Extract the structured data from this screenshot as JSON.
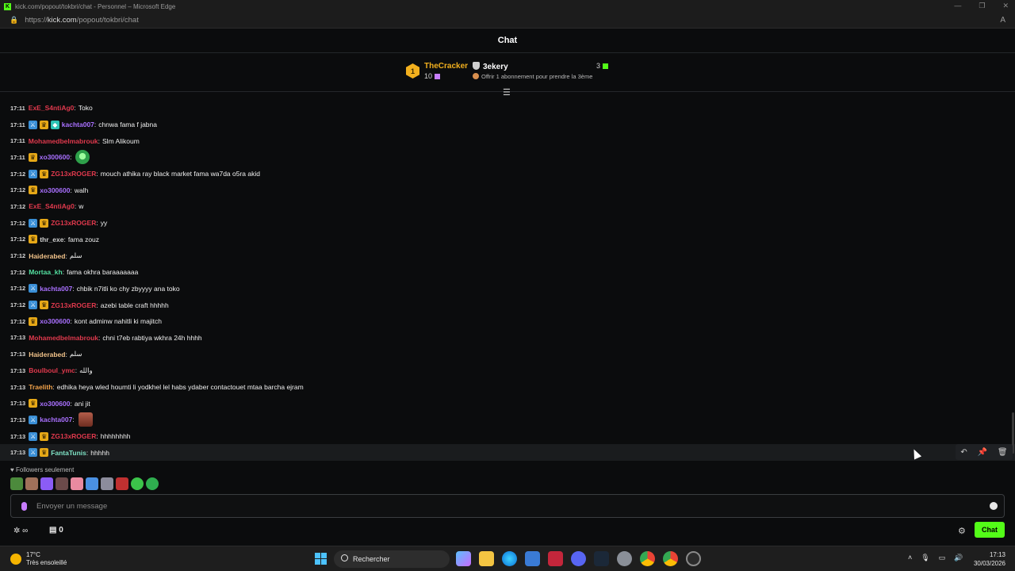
{
  "browser": {
    "title": "kick.com/popout/tokbri/chat - Personnel – Microsoft Edge",
    "url_prefix": "https://",
    "url_domain": "kick.com",
    "url_path": "/popout/tokbri/chat"
  },
  "chat": {
    "header_title": "Chat"
  },
  "gifters": {
    "first": {
      "rank": "1",
      "name": "TheCracker",
      "count": "10"
    },
    "second": {
      "name": "3ekery",
      "count": "3",
      "offer": "Offrir 1 abonnement pour prendre la 3ème"
    }
  },
  "messages": [
    {
      "time": "17:11",
      "badges": [],
      "user": "ExE_S4ntiAg0",
      "color": "#e0394d",
      "text": "Toko"
    },
    {
      "time": "17:11",
      "badges": [
        "mod",
        "sub",
        "vip"
      ],
      "user": "kachta007",
      "color": "#a970ff",
      "text": "chnwa fama f jabna"
    },
    {
      "time": "17:11",
      "badges": [],
      "user": "Mohamedbelmabrouk",
      "color": "#e0394d",
      "text": "Slm Alikoum"
    },
    {
      "time": "17:11",
      "badges": [
        "sub"
      ],
      "user": "xo300600",
      "color": "#a970ff",
      "text": "",
      "emote": "green"
    },
    {
      "time": "17:12",
      "badges": [
        "mod",
        "sub"
      ],
      "user": "ZG13xROGER",
      "color": "#e0394d",
      "text": "mouch athika ray black market fama wa7da o5ra akid"
    },
    {
      "time": "17:12",
      "badges": [
        "sub"
      ],
      "user": "xo300600",
      "color": "#a970ff",
      "text": "walh"
    },
    {
      "time": "17:12",
      "badges": [],
      "user": "ExE_S4ntiAg0",
      "color": "#e0394d",
      "text": "w"
    },
    {
      "time": "17:12",
      "badges": [
        "mod",
        "sub"
      ],
      "user": "ZG13xROGER",
      "color": "#e0394d",
      "text": "yy"
    },
    {
      "time": "17:12",
      "badges": [
        "sub"
      ],
      "user": "thr_exe",
      "color": "#cfcfcf",
      "text": "fama zouz"
    },
    {
      "time": "17:12",
      "badges": [],
      "user": "Haiderabed",
      "color": "#f2c38a",
      "text": "سلم"
    },
    {
      "time": "17:12",
      "badges": [],
      "user": "Mortaa_kh",
      "color": "#53e0a0",
      "text": "fama okhra baraaaaaaa"
    },
    {
      "time": "17:12",
      "badges": [
        "mod"
      ],
      "user": "kachta007",
      "color": "#a970ff",
      "text": "chbik n7itli ko chy zbyyyy ana toko"
    },
    {
      "time": "17:12",
      "badges": [
        "mod",
        "sub"
      ],
      "user": "ZG13xROGER",
      "color": "#e0394d",
      "text": "azebi table craft hhhhh"
    },
    {
      "time": "17:12",
      "badges": [
        "sub"
      ],
      "user": "xo300600",
      "color": "#a970ff",
      "text": "kont adminw nahitli ki majitch"
    },
    {
      "time": "17:13",
      "badges": [],
      "user": "Mohamedbelmabrouk",
      "color": "#e0394d",
      "text": "chni t7eb rabtiya wkhra 24h hhhh"
    },
    {
      "time": "17:13",
      "badges": [],
      "user": "Haiderabed",
      "color": "#f2c38a",
      "text": "سلم"
    },
    {
      "time": "17:13",
      "badges": [],
      "user": "Boulboul_ymc",
      "color": "#e0394d",
      "text": "والله"
    },
    {
      "time": "17:13",
      "badges": [],
      "user": "Traelith",
      "color": "#f2a24a",
      "text": "edhika heya wled houmti li yodkhel lel habs ydaber contactouet mtaa barcha ejram"
    },
    {
      "time": "17:13",
      "badges": [
        "sub"
      ],
      "user": "xo300600",
      "color": "#a970ff",
      "text": "ani jit"
    },
    {
      "time": "17:13",
      "badges": [
        "mod"
      ],
      "user": "kachta007",
      "color": "#a970ff",
      "text": "",
      "emote": "face"
    },
    {
      "time": "17:13",
      "badges": [
        "mod",
        "sub"
      ],
      "user": "ZG13xROGER",
      "color": "#e0394d",
      "text": "hhhhhhhh"
    },
    {
      "time": "17:13",
      "badges": [
        "mod",
        "sub"
      ],
      "user": "FantaTunis",
      "color": "#7fe3c6",
      "text": "hhhhh",
      "highlight": true
    }
  ],
  "composer": {
    "mode_label": "Followers seulement",
    "placeholder": "Envoyer un message",
    "points": "∞",
    "stock": "0",
    "send_label": "Chat"
  },
  "taskbar": {
    "temperature": "17°C",
    "weather_desc": "Très ensoleillé",
    "search_label": "Rechercher",
    "time": "17:13",
    "date": "30/03/2026"
  }
}
